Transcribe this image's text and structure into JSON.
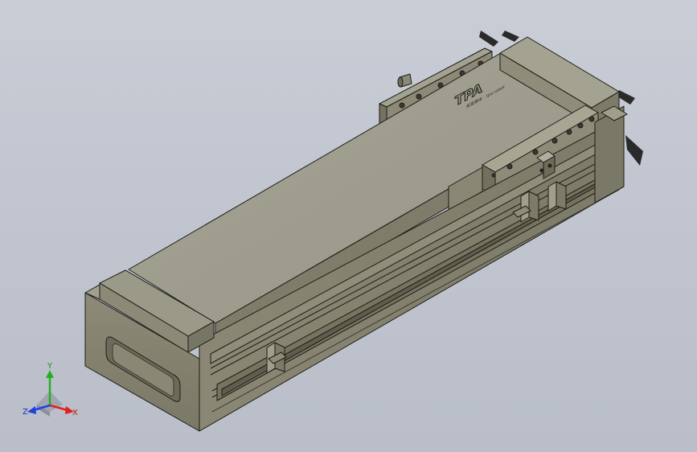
{
  "viewport": {
    "background": "#c4c8d1"
  },
  "model": {
    "body_color": "#878570",
    "top_color": "#9e9c88",
    "dark_color": "#5c5a4a",
    "edge_color": "#1c1c18",
    "logo_text": "TPA",
    "logo_subtext": "拓富德米 · tpa-robot"
  },
  "triad": {
    "x_label": "X",
    "y_label": "Y",
    "z_label": "Z",
    "x_color": "#e02020",
    "y_color": "#22b022",
    "z_color": "#2040e0"
  }
}
